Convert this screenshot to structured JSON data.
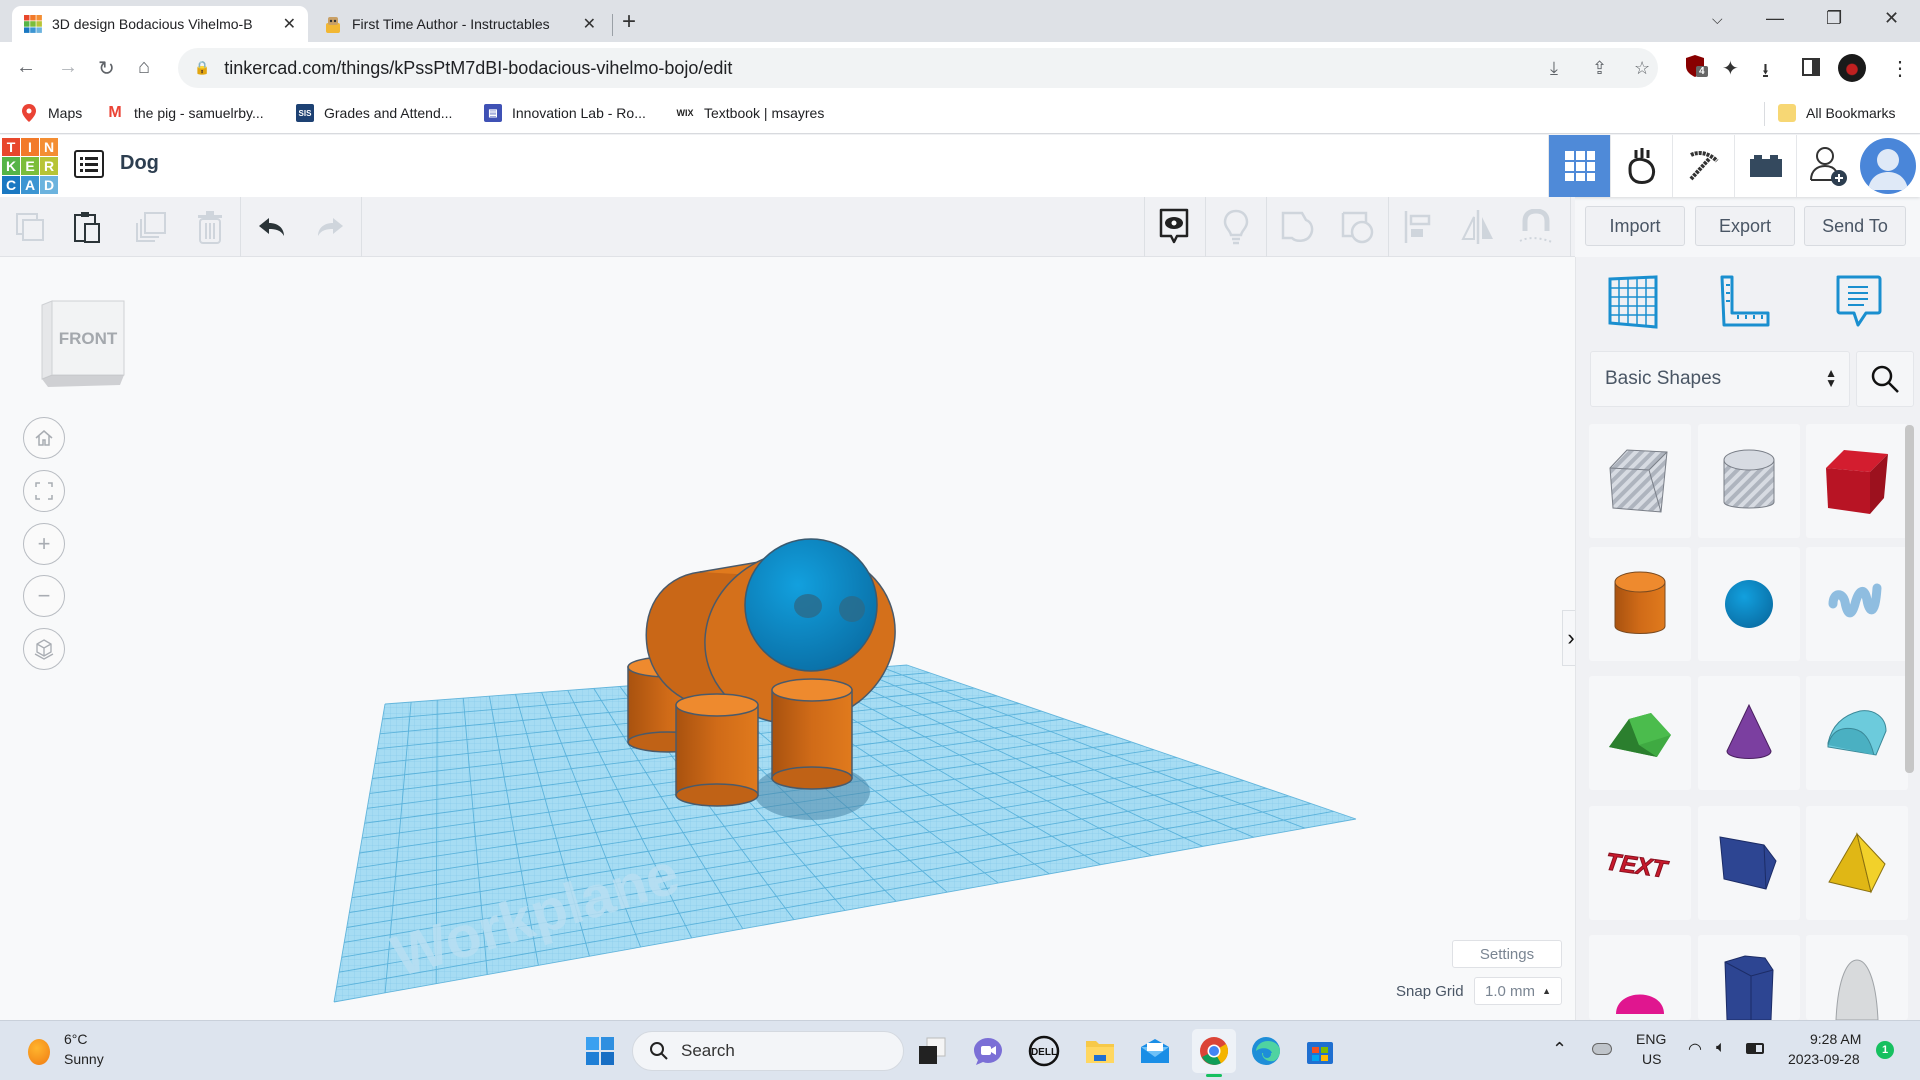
{
  "browser": {
    "tabs": [
      {
        "title": "3D design Bodacious Vihelmo-B",
        "active": true,
        "favicon": "tinkercad-icon"
      },
      {
        "title": "First Time Author - Instructables",
        "active": false,
        "favicon": "instructables-robot-icon"
      }
    ],
    "new_tab_label": "+",
    "url": "tinkercad.com/things/kPssPtM7dBI-bodacious-vihelmo-bojo/edit",
    "extension_badge": "4",
    "bookmarks": [
      {
        "label": "Maps",
        "icon": "maps-pin-icon"
      },
      {
        "label": "the pig - samuelrby...",
        "icon": "gmail-icon"
      },
      {
        "label": "Grades and Attend...",
        "icon": "sis-icon",
        "icon_text": "SIS"
      },
      {
        "label": "Innovation Lab - Ro...",
        "icon": "forms-icon"
      },
      {
        "label": "Textbook | msayres",
        "icon": "wix-icon",
        "icon_text": "WIX"
      }
    ],
    "all_bookmarks_label": "All Bookmarks"
  },
  "tinkercad": {
    "logo_letters": [
      "T",
      "I",
      "N",
      "K",
      "E",
      "R",
      "C",
      "A",
      "D"
    ],
    "logo_colors": [
      "#e8472c",
      "#f27a2a",
      "#f48e33",
      "#56b447",
      "#7cbd3a",
      "#b7c436",
      "#1a78c2",
      "#3c95d2",
      "#6cb3de"
    ],
    "design_title": "Dog",
    "header_buttons": [
      "3d-view-grid-icon",
      "tinker-hand-icon",
      "pickaxe-icon",
      "bricks-icon",
      "invite-user-icon"
    ],
    "toolbar": {
      "import_label": "Import",
      "export_label": "Export",
      "send_to_label": "Send To"
    },
    "viewcube_label": "FRONT",
    "workplane_label": "Workplane",
    "settings_label": "Settings",
    "snap_grid_label": "Snap Grid",
    "snap_grid_value": "1.0 mm",
    "library_selected": "Basic Shapes",
    "shapes": [
      {
        "name": "box-hole",
        "color": "#b8bec8"
      },
      {
        "name": "cylinder-hole",
        "color": "#c0c5cd"
      },
      {
        "name": "box",
        "color": "#c8192b"
      },
      {
        "name": "cylinder",
        "color": "#e07a1d"
      },
      {
        "name": "sphere",
        "color": "#0f8fcd"
      },
      {
        "name": "scribble",
        "color": "#8fbde0"
      },
      {
        "name": "roof",
        "color": "#3faa42"
      },
      {
        "name": "cone",
        "color": "#7b3fa0"
      },
      {
        "name": "round-roof",
        "color": "#5ec2d3"
      },
      {
        "name": "text",
        "color": "#c8192b",
        "label": "TEXT"
      },
      {
        "name": "wedge-polygon",
        "color": "#2d4592"
      },
      {
        "name": "pyramid",
        "color": "#e6c11a"
      },
      {
        "name": "half-sphere",
        "color": "#e0168f"
      },
      {
        "name": "hexagonal-prism",
        "color": "#2d4592"
      },
      {
        "name": "paraboloid",
        "color": "#d8dadc"
      }
    ],
    "model": {
      "body_color": "#e07a1d",
      "head_color": "#0f8fcd",
      "workplane_color": "#8fd0ef"
    }
  },
  "taskbar": {
    "weather_temp": "6°C",
    "weather_desc": "Sunny",
    "search_placeholder": "Search",
    "language": "ENG",
    "region": "US",
    "time": "9:28 AM",
    "date": "2023-09-28",
    "notification_count": "1"
  }
}
